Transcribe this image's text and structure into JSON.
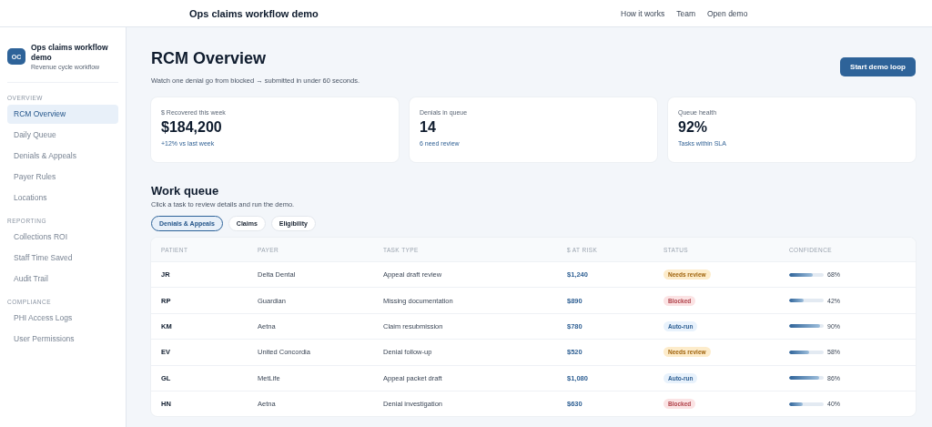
{
  "topbar": {
    "title": "Ops claims workflow demo",
    "links": [
      "How it works",
      "Team",
      "Open demo"
    ]
  },
  "sidebar": {
    "logo": "OC",
    "app_name": "Ops claims workflow demo",
    "app_subtitle": "Revenue cycle workflow",
    "sections": [
      {
        "heading": "OVERVIEW",
        "items": [
          {
            "label": "RCM Overview",
            "selected": true
          },
          {
            "label": "Daily Queue",
            "selected": false
          },
          {
            "label": "Denials & Appeals",
            "selected": false
          },
          {
            "label": "Payer Rules",
            "selected": false
          },
          {
            "label": "Locations",
            "selected": false
          }
        ]
      },
      {
        "heading": "REPORTING",
        "items": [
          {
            "label": "Collections ROI",
            "selected": false
          },
          {
            "label": "Staff Time Saved",
            "selected": false
          },
          {
            "label": "Audit Trail",
            "selected": false
          }
        ]
      },
      {
        "heading": "COMPLIANCE",
        "items": [
          {
            "label": "PHI Access Logs",
            "selected": false
          },
          {
            "label": "User Permissions",
            "selected": false
          }
        ]
      }
    ]
  },
  "page": {
    "title": "RCM Overview",
    "subtitle": "Watch one denial go from blocked → submitted in under 60 seconds.",
    "button": "Start demo loop"
  },
  "stats": [
    {
      "label": "$ Recovered this week",
      "value": "$184,200",
      "note": "+12% vs last week"
    },
    {
      "label": "Denials in queue",
      "value": "14",
      "note": "6 need review"
    },
    {
      "label": "Queue health",
      "value": "92%",
      "note": "Tasks within SLA"
    }
  ],
  "work_queue": {
    "title": "Work queue",
    "subtitle": "Click a task to review details and run the demo.",
    "tabs": [
      {
        "label": "Denials & Appeals",
        "selected": true
      },
      {
        "label": "Claims",
        "selected": false
      },
      {
        "label": "Eligibility",
        "selected": false
      }
    ],
    "table": {
      "columns": [
        "PATIENT",
        "PAYER",
        "TASK TYPE",
        "$ AT RISK",
        "STATUS",
        "CONFIDENCE"
      ],
      "rows": [
        {
          "patient": "JR",
          "payer": "Delta Dental",
          "task": "Appeal draft review",
          "amount": "$1,240",
          "status": {
            "label": "Needs review",
            "kind": "review"
          },
          "level": 0.68,
          "confidence": "68%"
        },
        {
          "patient": "RP",
          "payer": "Guardian",
          "task": "Missing documentation",
          "amount": "$890",
          "status": {
            "label": "Blocked",
            "kind": "blocked"
          },
          "level": 0.42,
          "confidence": "42%"
        },
        {
          "patient": "KM",
          "payer": "Aetna",
          "task": "Claim resubmission",
          "amount": "$780",
          "status": {
            "label": "Auto-run",
            "kind": "auto"
          },
          "level": 0.9,
          "confidence": "90%"
        },
        {
          "patient": "EV",
          "payer": "United Concordia",
          "task": "Denial follow-up",
          "amount": "$520",
          "status": {
            "label": "Needs review",
            "kind": "review"
          },
          "level": 0.58,
          "confidence": "58%"
        },
        {
          "patient": "GL",
          "payer": "MetLife",
          "task": "Appeal packet draft",
          "amount": "$1,080",
          "status": {
            "label": "Auto-run",
            "kind": "auto"
          },
          "level": 0.86,
          "confidence": "86%"
        },
        {
          "patient": "HN",
          "payer": "Aetna",
          "task": "Denial investigation",
          "amount": "$630",
          "status": {
            "label": "Blocked",
            "kind": "blocked"
          },
          "level": 0.4,
          "confidence": "40%"
        }
      ]
    }
  }
}
